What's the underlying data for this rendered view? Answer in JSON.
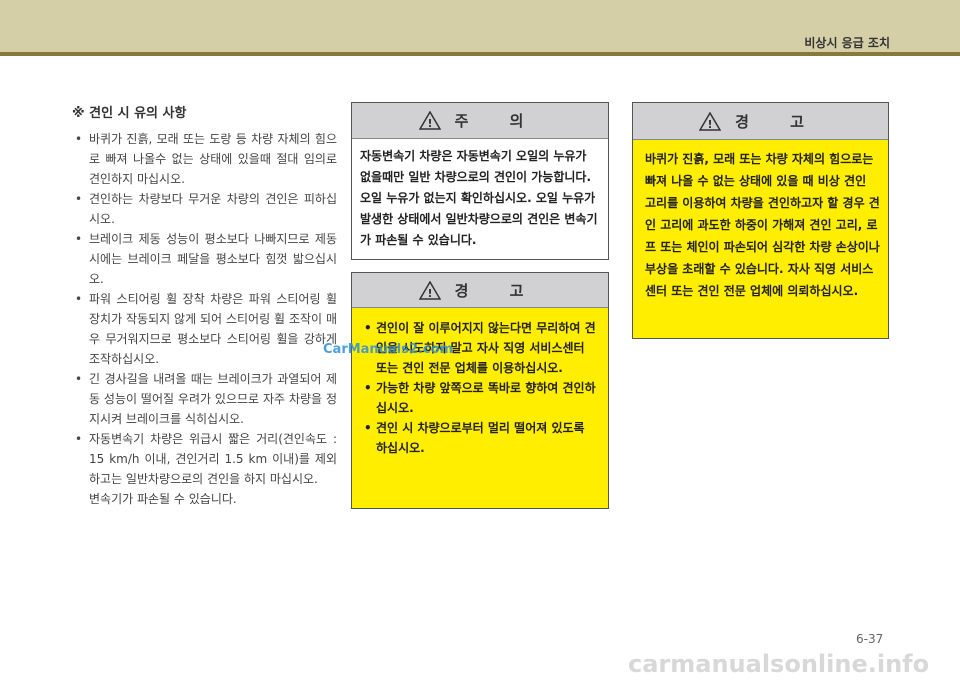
{
  "header": {
    "title": "비상시 응급 조치",
    "bg_color": "#d4cfa6",
    "rule_color": "#857a3c"
  },
  "notes": {
    "title": "※ 견인 시 유의 사항",
    "items": [
      "바퀴가 진흙, 모래 또는 도랑 등 차량 자체의 힘으로 빠져 나올수 없는 상태에 있을때 절대 임의로 견인하지 마십시오.",
      "견인하는 차량보다 무거운 차량의 견인은 피하십시오.",
      "브레이크 제동 성능이 평소보다 나빠지므로 제동시에는 브레이크 페달을 평소보다 힘껏 밟으십시오.",
      "파워 스티어링 휠 장착 차량은 파워 스티어링 휠 장치가 작동되지 않게 되어 스티어링 휠 조작이 매우 무거워지므로 평소보다 스티어링 휠을 강하게 조작하십시오.",
      "긴 경사길을 내려올 때는 브레이크가 과열되어 제동 성능이 떨어질 우려가 있으므로 자주 차량을 정지시켜 브레이크를 식히십시오.",
      "자동변속기 차량은 위급시 짧은 거리(견인속도 : 15 km/h 이내, 견인거리 1.5 km 이내)를 제외하고는 일반차량으로의 견인을 하지 마십시오."
    ],
    "trailing": "변속기가 파손될 수 있습니다."
  },
  "caution": {
    "title": "주 의",
    "icon": "warning-triangle-icon",
    "text": "자동변속기 차량은 자동변속기 오일의 누유가 없을때만 일반 차량으로의 견인이 가능합니다. 오일 누유가 없는지 확인하십시오. 오일 누유가 발생한 상태에서 일반차량으로의 견인은 변속기가 파손될 수 있습니다."
  },
  "warning_left": {
    "title": "경 고",
    "icon": "warning-triangle-icon",
    "bg_color": "#ffee00",
    "items": [
      "견인이 잘 이루어지지 않는다면 무리하여 견인을 시도하지 말고 자사 직영 서비스센터 또는 견인 전문 업체를 이용하십시오.",
      "가능한 차량 앞쪽으로 똑바로 향하여 견인하십시오.",
      "견인 시 차량으로부터 멀리 떨어져 있도록 하십시오."
    ]
  },
  "warning_right": {
    "title": "경 고",
    "icon": "warning-triangle-icon",
    "bg_color": "#ffee00",
    "text": "바퀴가 진흙, 모래 또는 차량 자체의 힘으로는 빠져 나올 수 없는 상태에 있을 때 비상 견인 고리를 이용하여 차량을 견인하고자 할 경우 견인 고리에 과도한 하중이 가해져 견인 고리, 로프 또는 체인이 파손되어 심각한 차량 손상이나 부상을 초래할 수 있습니다. 자사 직영 서비스센터 또는 견인 전문 업체에 의뢰하십시오."
  },
  "watermark": "CarManuals2.com",
  "page_number": "6-37",
  "footer_watermark": "carmanualsonline.info"
}
